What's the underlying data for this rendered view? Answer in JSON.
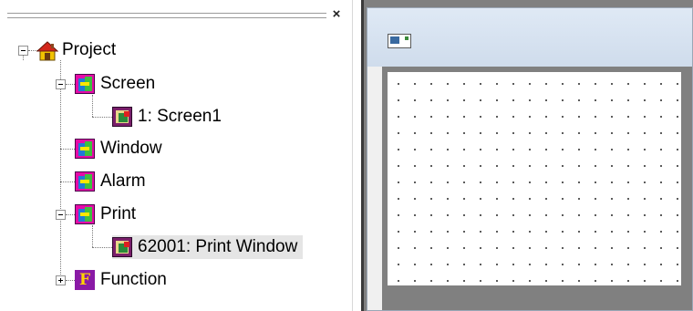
{
  "tree": {
    "root": {
      "label": "Project",
      "icon": "home-icon"
    },
    "items": [
      {
        "label": "Screen",
        "icon": "folder-icon",
        "expanded": true,
        "children": [
          {
            "label": "1: Screen1",
            "icon": "screen-icon"
          }
        ]
      },
      {
        "label": "Window",
        "icon": "folder-icon"
      },
      {
        "label": "Alarm",
        "icon": "folder-icon"
      },
      {
        "label": "Print",
        "icon": "folder-icon",
        "expanded": true,
        "children": [
          {
            "label": "62001: Print Window",
            "icon": "screen-icon",
            "selected": true
          }
        ]
      },
      {
        "label": "Function",
        "icon": "function-icon",
        "expanded": false,
        "glyph": "F"
      }
    ]
  },
  "pane": {
    "close_glyph": "×"
  },
  "colors": {
    "folder_icon": "#e60aa8",
    "function_icon": "#8a1aa6",
    "selection": "#e5e5e5",
    "workspace": "#808080",
    "titlebar": "#dfe9f5"
  }
}
